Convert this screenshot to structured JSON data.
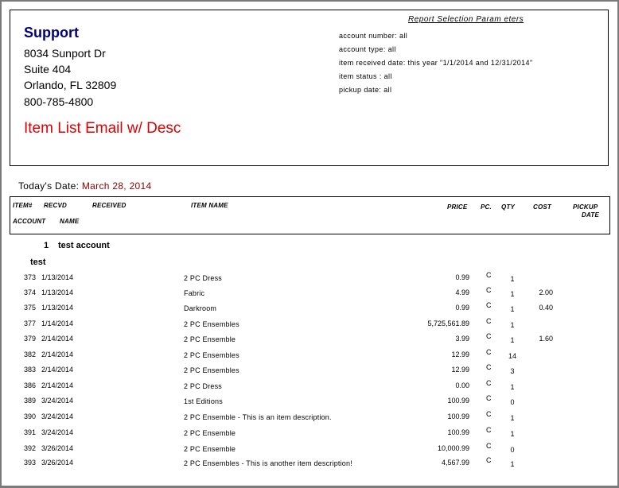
{
  "company": {
    "name": "Support",
    "address_lines": [
      "8034 Sunport Dr",
      "Suite 404",
      "Orlando, FL 32809",
      "800-785-4800"
    ]
  },
  "report_title": "Item List Email w/ Desc",
  "parameters": {
    "title": "Report Selection Param eters",
    "lines": [
      "account number: all",
      "account type: all",
      "item received date: this year \"1/1/2014 and 12/31/2014\"",
      "item status : all",
      "pickup date: all"
    ]
  },
  "today": {
    "label": "Today's Date:",
    "value": "March 28, 2014"
  },
  "columns": {
    "item": "ITEM#",
    "recvd": "RECVD",
    "received": "RECEIVED",
    "item_name": "ITEM NAME",
    "price": "PRICE",
    "pc": "PC.",
    "qty": "QTY",
    "cost": "COST",
    "pickup1": "PICKUP",
    "pickup2": "DATE",
    "account": "ACCOUNT",
    "name": "NAME"
  },
  "group": {
    "account_number": "1",
    "account_name": "test account",
    "name": "test"
  },
  "rows": [
    {
      "item": "373",
      "recvd": "1/13/2014",
      "name": "2 PC Dress",
      "price": "0.99",
      "pc": "C",
      "qty": "1",
      "cost": ""
    },
    {
      "item": "374",
      "recvd": "1/13/2014",
      "name": "Fabric",
      "price": "4.99",
      "pc": "C",
      "qty": "1",
      "cost": "2.00"
    },
    {
      "item": "375",
      "recvd": "1/13/2014",
      "name": "Darkroom",
      "price": "0.99",
      "pc": "C",
      "qty": "1",
      "cost": "0.40"
    },
    {
      "item": "377",
      "recvd": "1/14/2014",
      "name": "2 PC Ensembles",
      "price": "5,725,561.89",
      "pc": "C",
      "qty": "1",
      "cost": ""
    },
    {
      "item": "379",
      "recvd": "2/14/2014",
      "name": "2 PC Ensemble",
      "price": "3.99",
      "pc": "C",
      "qty": "1",
      "cost": "1.60"
    },
    {
      "item": "382",
      "recvd": "2/14/2014",
      "name": "2 PC Ensembles",
      "price": "12.99",
      "pc": "C",
      "qty": "14",
      "cost": ""
    },
    {
      "item": "383",
      "recvd": "2/14/2014",
      "name": "2 PC Ensembles",
      "price": "12.99",
      "pc": "C",
      "qty": "3",
      "cost": ""
    },
    {
      "item": "386",
      "recvd": "2/14/2014",
      "name": "2 PC Dress",
      "price": "0.00",
      "pc": "C",
      "qty": "1",
      "cost": ""
    },
    {
      "item": "389",
      "recvd": "3/24/2014",
      "name": "1st Editions",
      "price": "100.99",
      "pc": "C",
      "qty": "0",
      "cost": ""
    },
    {
      "item": "390",
      "recvd": "3/24/2014",
      "name": "2 PC Ensemble - This is an item description.",
      "price": "100.99",
      "pc": "C",
      "qty": "1",
      "cost": ""
    },
    {
      "item": "391",
      "recvd": "3/24/2014",
      "name": "2 PC Ensemble",
      "price": "100.99",
      "pc": "C",
      "qty": "1",
      "cost": ""
    },
    {
      "item": "392",
      "recvd": "3/26/2014",
      "name": "2 PC Ensemble",
      "price": "10,000.99",
      "pc": "C",
      "qty": "0",
      "cost": ""
    },
    {
      "item": "393",
      "recvd": "3/26/2014",
      "name": "2 PC Ensembles - This is another item description!",
      "price": "4,567.99",
      "pc": "C",
      "qty": "1",
      "cost": ""
    }
  ]
}
